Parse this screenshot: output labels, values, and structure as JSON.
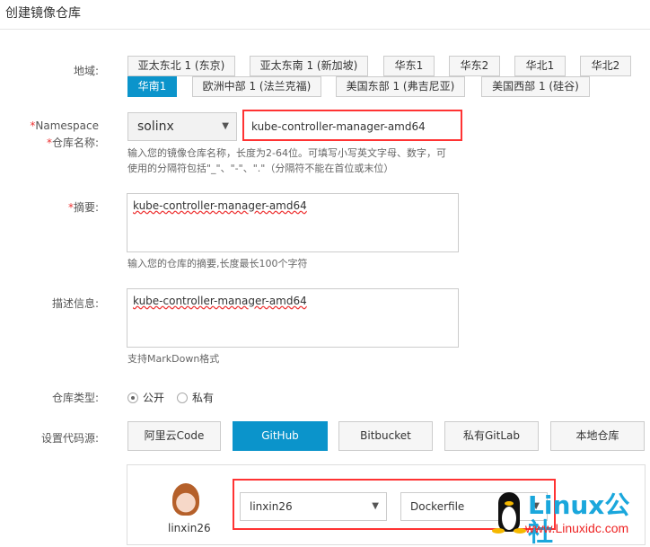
{
  "title": "创建镜像仓库",
  "region": {
    "label": "地域:",
    "options": [
      "亚太东北 1 (东京)",
      "亚太东南 1 (新加坡)",
      "华东1",
      "华东2",
      "华北1",
      "华北2",
      "华南1",
      "欧洲中部 1 (法兰克福)",
      "美国东部 1 (弗吉尼亚)",
      "美国西部 1 (硅谷)"
    ],
    "selected": "华南1"
  },
  "namespace": {
    "label": "Namespace",
    "value": "solinx"
  },
  "repo_name": {
    "label": "仓库名称:",
    "value": "kube-controller-manager-amd64",
    "hint": "输入您的镜像仓库名称，长度为2-64位。可填写小写英文字母、数字，可使用的分隔符包括\"_\"、\"-\"、\".\"（分隔符不能在首位或末位）"
  },
  "summary": {
    "label": "摘要:",
    "value": "kube-controller-manager-amd64",
    "hint": "输入您的仓库的摘要,长度最长100个字符"
  },
  "description": {
    "label": "描述信息:",
    "value": "kube-controller-manager-amd64",
    "hint": "支持MarkDown格式"
  },
  "repo_type": {
    "label": "仓库类型:",
    "options": [
      "公开",
      "私有"
    ],
    "selected": "公开"
  },
  "code_source": {
    "label": "设置代码源:",
    "options": [
      "阿里云Code",
      "GitHub",
      "Bitbucket",
      "私有GitLab",
      "本地仓库"
    ],
    "selected": "GitHub"
  },
  "account": {
    "username": "linxin26",
    "org": "linxin26",
    "repo": "Dockerfile"
  },
  "watermark": {
    "brand": "Linux公社",
    "url": "www.Linuxidc.com"
  }
}
